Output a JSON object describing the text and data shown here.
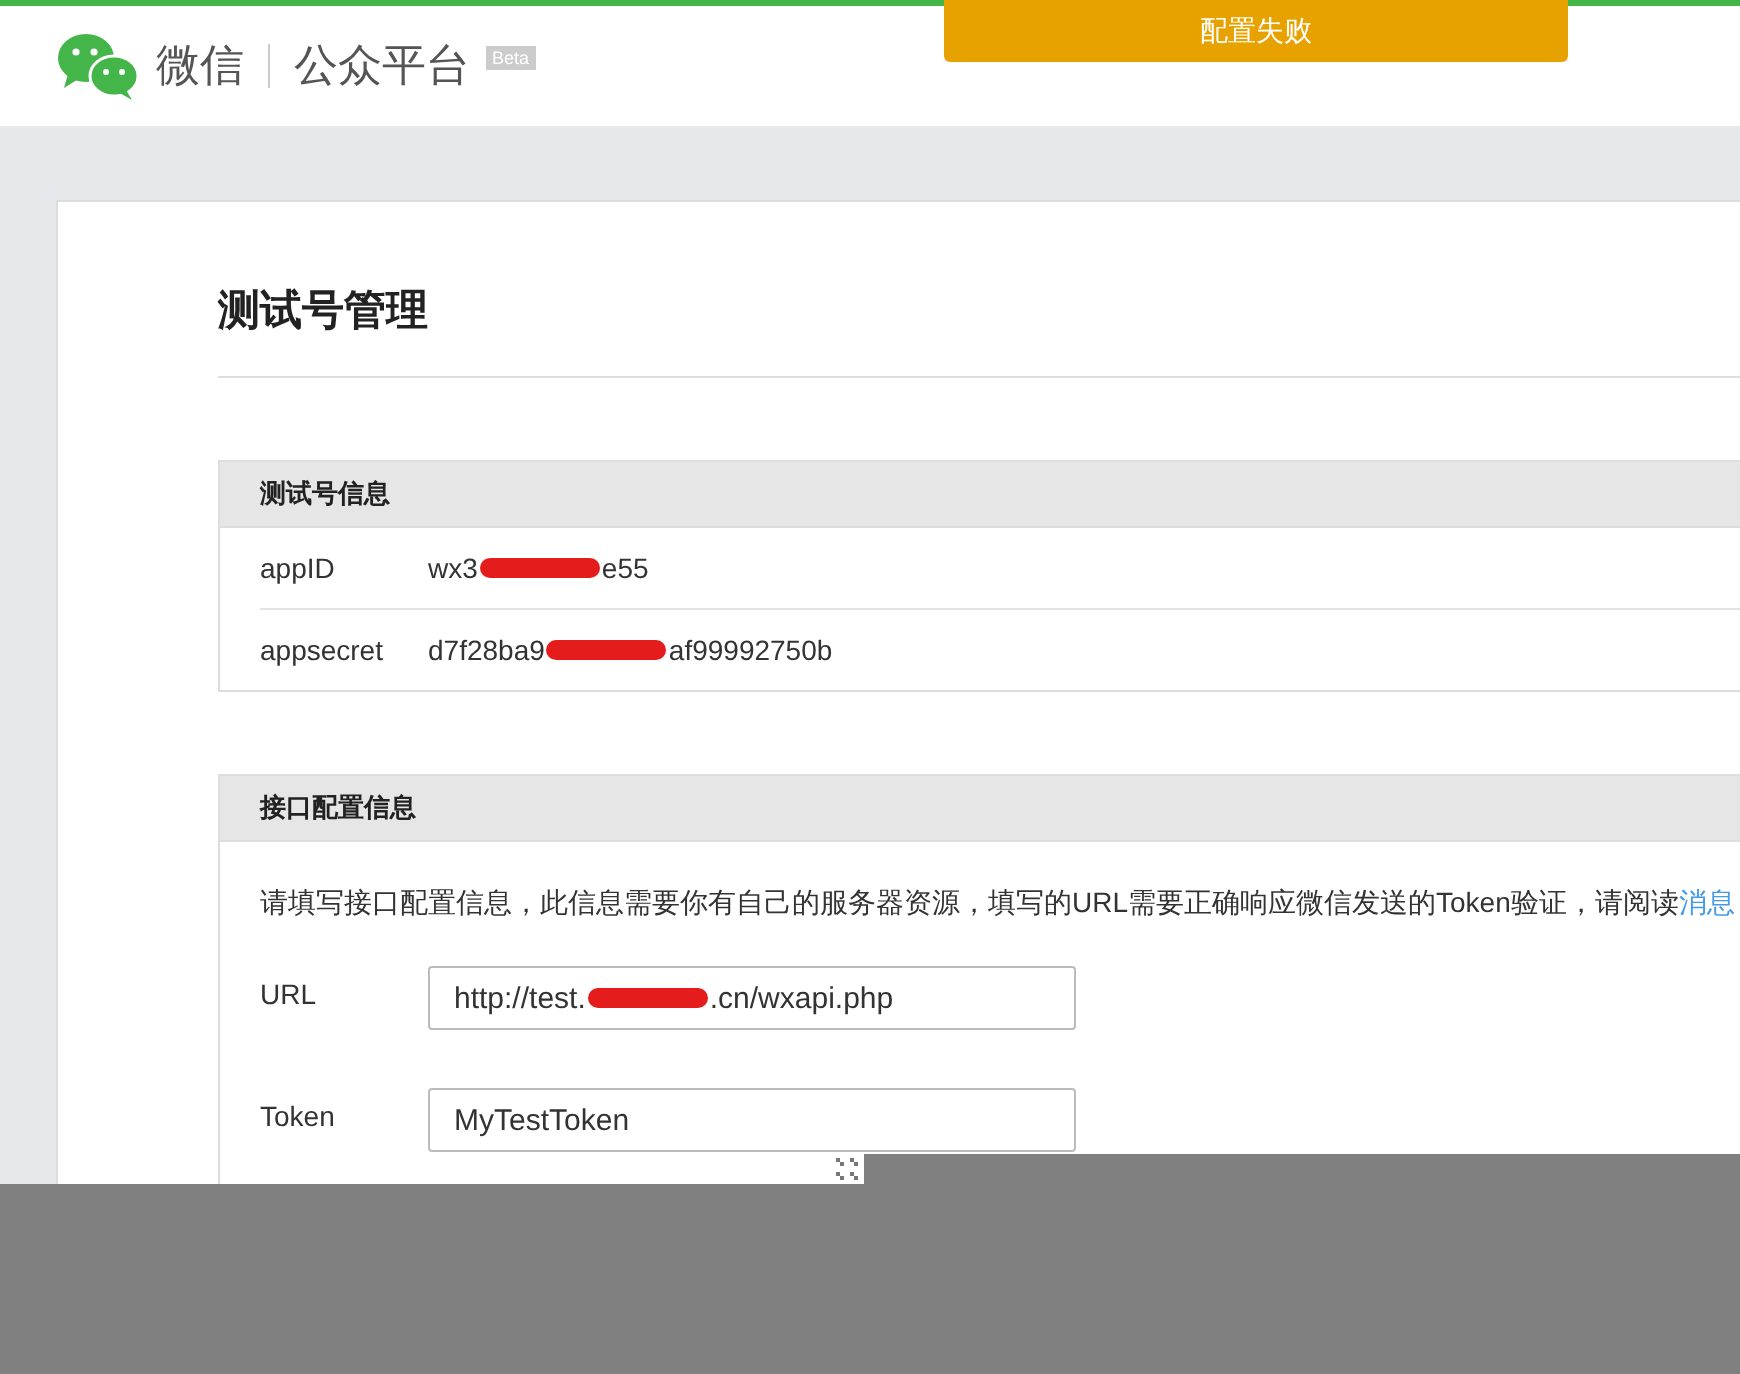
{
  "header": {
    "logo_text": "微信",
    "product": "公众平台",
    "badge": "Beta"
  },
  "toast": {
    "message": "配置失败"
  },
  "page_title": "测试号管理",
  "account_info": {
    "title": "测试号信息",
    "rows": [
      {
        "label": "appID",
        "value_before": "wx3",
        "value_after": "e55",
        "redacted": true
      },
      {
        "label": "appsecret",
        "value_before": "d7f28ba9",
        "value_after": "af99992750b",
        "redacted": true
      }
    ]
  },
  "interface_config": {
    "title": "接口配置信息",
    "description": "请填写接口配置信息，此信息需要你有自己的服务器资源，填写的URL需要正确响应微信发送的Token验证，请阅读",
    "link": "消息",
    "fields": [
      {
        "label": "URL",
        "value_before": "http://test.",
        "value_after": ".cn/wxapi.php",
        "redacted": true
      },
      {
        "label": "Token",
        "value_before": "MyTestToken",
        "redacted": false
      }
    ]
  }
}
